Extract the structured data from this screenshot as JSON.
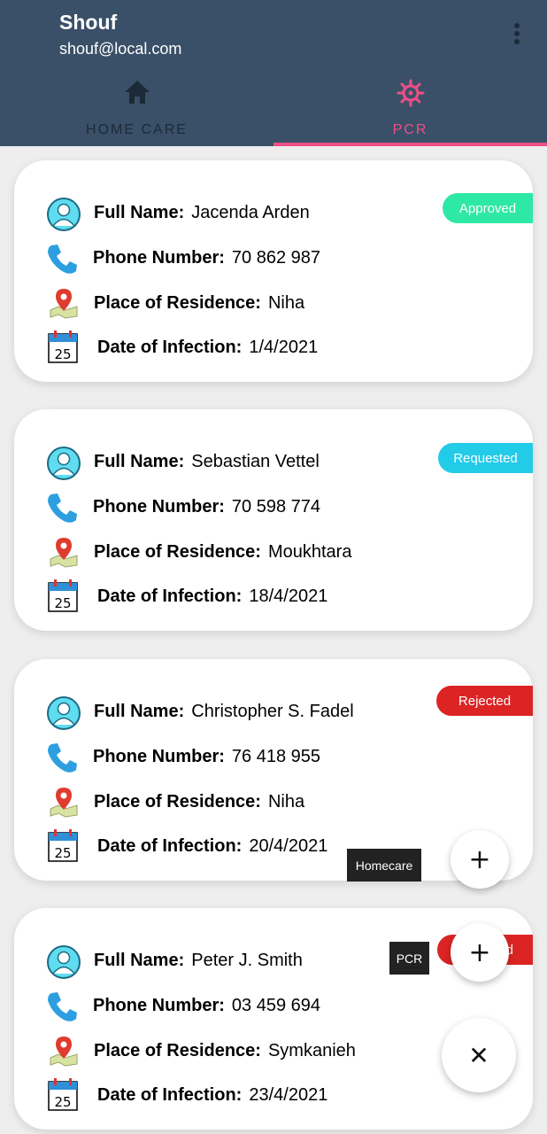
{
  "app": {
    "title": "Shouf",
    "email": "shouf@local.com"
  },
  "tabs": [
    {
      "label": "HOME CARE",
      "icon": "home-icon"
    },
    {
      "label": "PCR",
      "icon": "virus-icon",
      "active": true
    }
  ],
  "labels": {
    "full_name": "Full Name:",
    "phone": "Phone Number:",
    "residence": "Place of Residence:",
    "infection": "Date of Infection:"
  },
  "calendar_day": "25",
  "colors": {
    "appbar": "#3a5068",
    "accent": "#ee4f86",
    "approved": "#2ee8a6",
    "requested": "#22cbe8",
    "rejected": "#dc2424"
  },
  "cards": [
    {
      "name": "Jacenda Arden",
      "phone": "70 862 987",
      "residence": "Niha",
      "date": "1/4/2021",
      "status": "Approved"
    },
    {
      "name": "Sebastian Vettel",
      "phone": "70 598 774",
      "residence": "Moukhtara",
      "date": "18/4/2021",
      "status": "Requested"
    },
    {
      "name": "Christopher S. Fadel",
      "phone": "76 418 955",
      "residence": "Niha",
      "date": "20/4/2021",
      "status": "Rejected"
    },
    {
      "name": "Peter J. Smith",
      "phone": "03 459 694",
      "residence": "Symkanieh",
      "date": "23/4/2021",
      "status": "d"
    }
  ],
  "fab": {
    "homecare_tooltip": "Homecare",
    "pcr_tooltip": "PCR",
    "add_symbol": "+",
    "close_symbol": "✕"
  }
}
